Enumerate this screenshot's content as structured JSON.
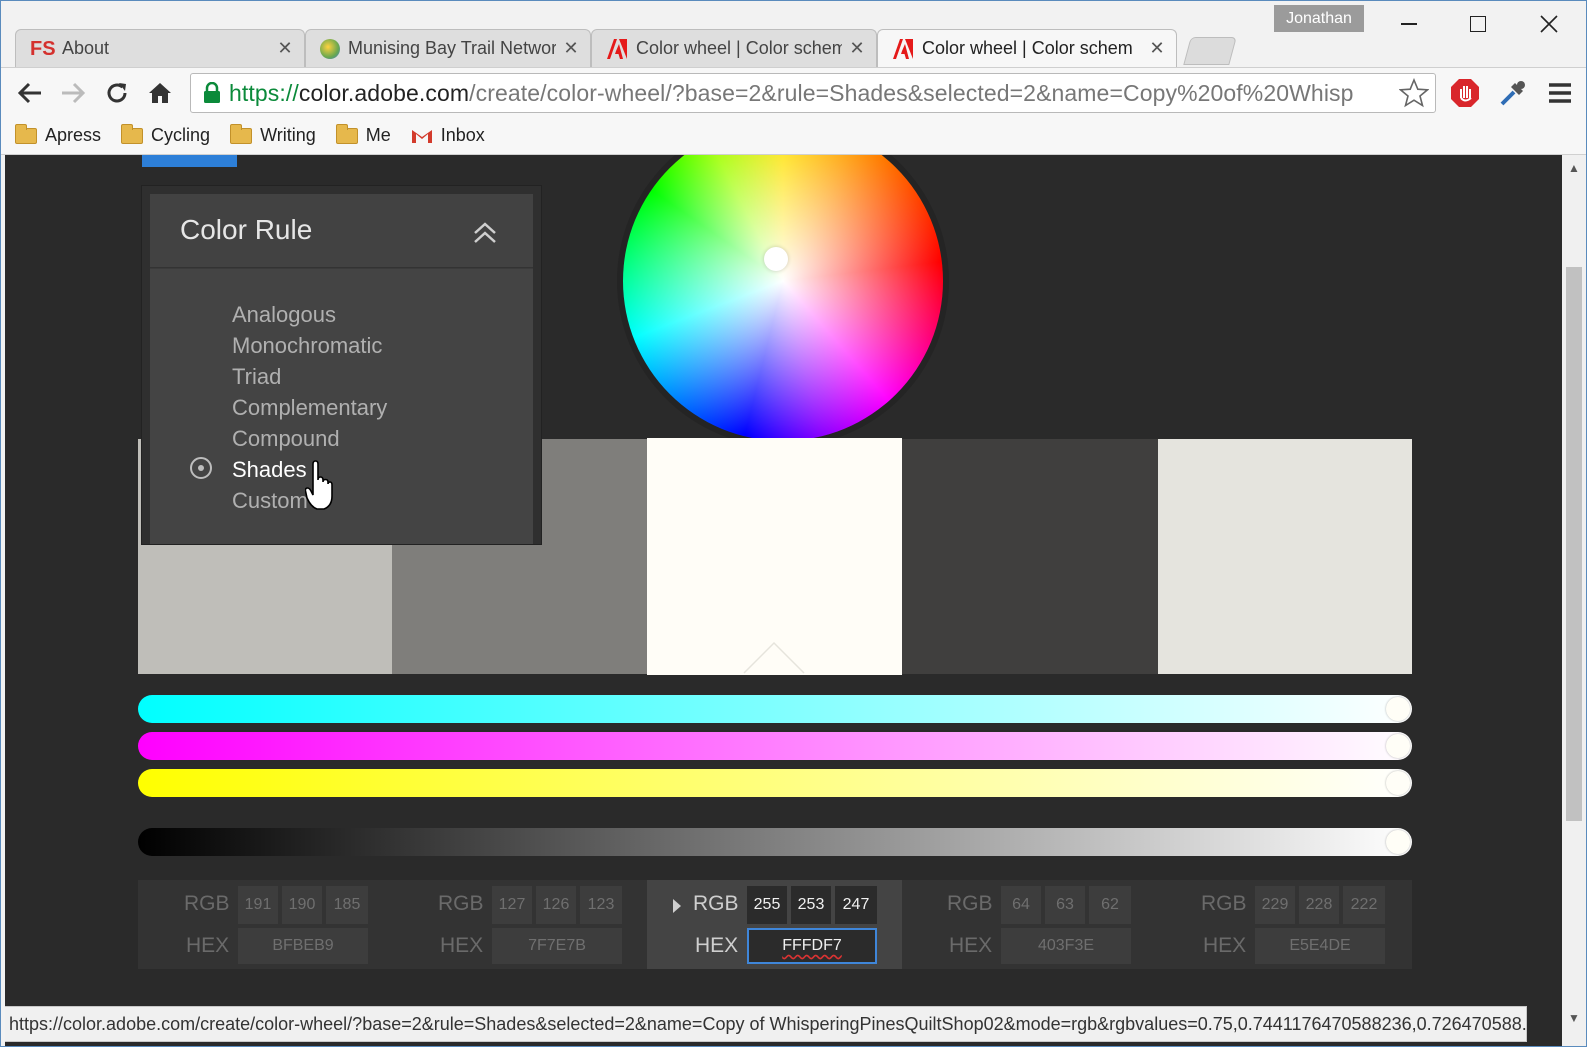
{
  "window": {
    "user": "Jonathan"
  },
  "tabs": [
    {
      "label": "About",
      "icon": "fs-favicon"
    },
    {
      "label": "Munising Bay Trail Networ",
      "icon": "globe-favicon"
    },
    {
      "label": "Color wheel | Color schem",
      "icon": "adobe-favicon"
    },
    {
      "label": "Color wheel | Color schem",
      "icon": "adobe-favicon",
      "active": true
    }
  ],
  "address": {
    "scheme": "https://",
    "host": "color.adobe.com",
    "path": "/create/color-wheel/?base=2&rule=Shades&selected=2&name=Copy%20of%20Whisp"
  },
  "bookmarks": [
    {
      "label": "Apress",
      "icon": "folder-icon"
    },
    {
      "label": "Cycling",
      "icon": "folder-icon"
    },
    {
      "label": "Writing",
      "icon": "folder-icon"
    },
    {
      "label": "Me",
      "icon": "folder-icon"
    },
    {
      "label": "Inbox",
      "icon": "gmail-icon"
    }
  ],
  "color_rule": {
    "title": "Color Rule",
    "items": [
      "Analogous",
      "Monochromatic",
      "Triad",
      "Complementary",
      "Compound",
      "Shades",
      "Custom"
    ],
    "selected": "Shades"
  },
  "swatches": [
    {
      "rgb": [
        "191",
        "190",
        "185"
      ],
      "hex": "BFBEB9",
      "color": "#bfbeb9"
    },
    {
      "rgb": [
        "127",
        "126",
        "123"
      ],
      "hex": "7F7E7B",
      "color": "#7f7e7b"
    },
    {
      "rgb": [
        "255",
        "253",
        "247"
      ],
      "hex": "FFFDF7",
      "color": "#fffdf7",
      "active": true
    },
    {
      "rgb": [
        "64",
        "63",
        "62"
      ],
      "hex": "403F3E",
      "color": "#403f3e"
    },
    {
      "rgb": [
        "229",
        "228",
        "222"
      ],
      "hex": "E5E4DE",
      "color": "#e5e4de"
    }
  ],
  "labels": {
    "rgb": "RGB",
    "hex": "HEX"
  },
  "status_bar": "https://color.adobe.com/create/color-wheel/?base=2&rule=Shades&selected=2&name=Copy of WhisperingPinesQuiltShop02&mode=rgb&rgbvalues=0.75,0.7441176470588236,0.726470588..."
}
